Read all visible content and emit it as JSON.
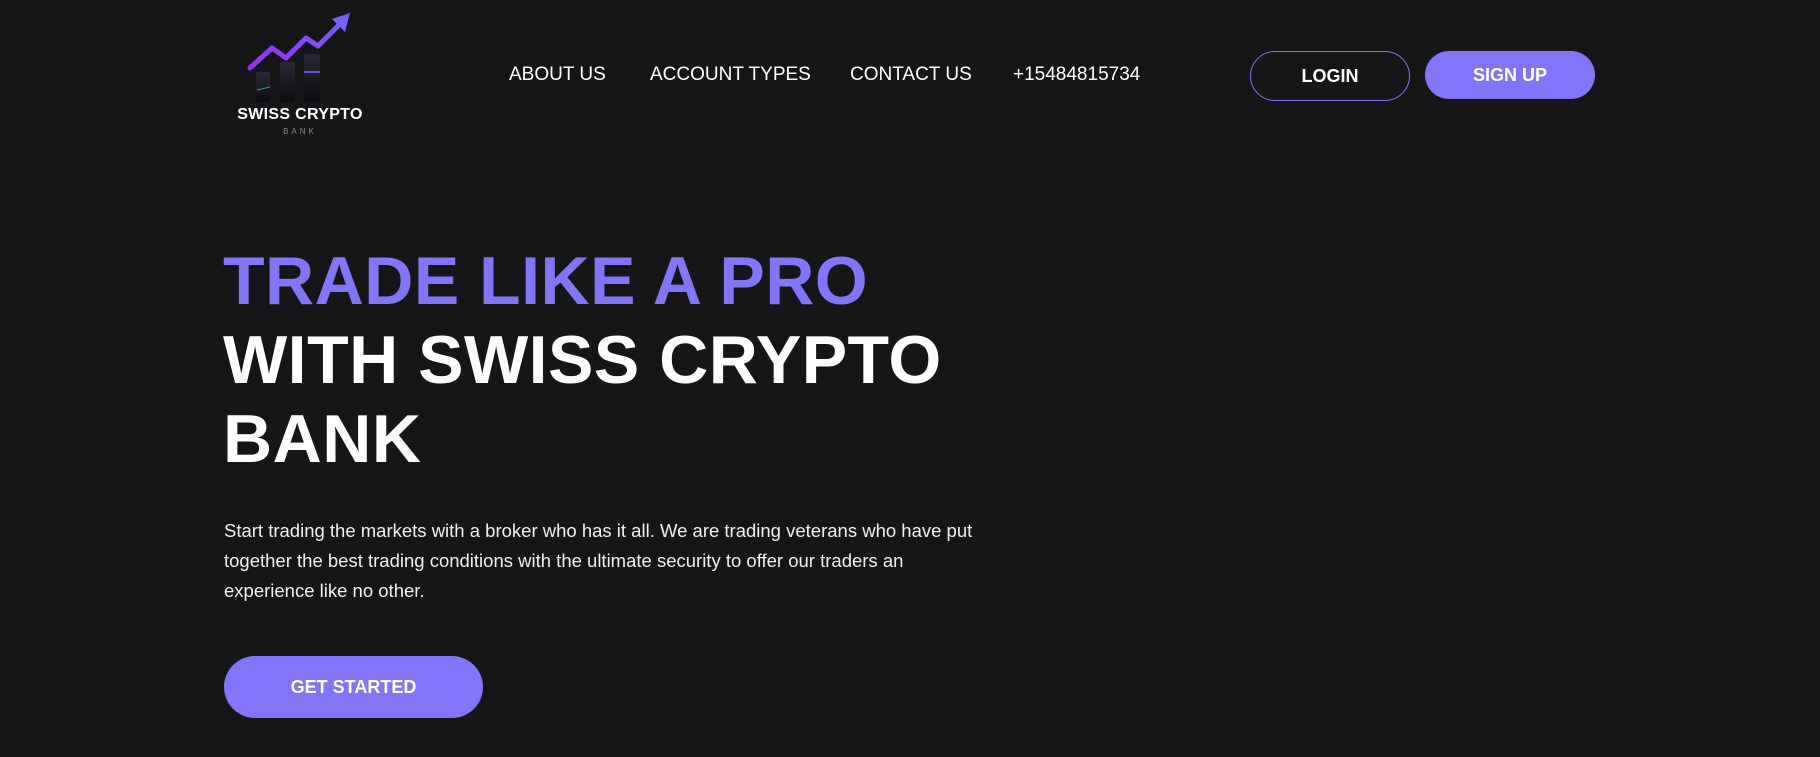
{
  "brand": {
    "name": "SWISS CRYPTO",
    "subname": "BANK",
    "accent_color": "#8275f7",
    "background_color": "#161618"
  },
  "nav": {
    "items": [
      {
        "label": "ABOUT US"
      },
      {
        "label": "ACCOUNT TYPES"
      },
      {
        "label": "CONTACT US"
      },
      {
        "label": "+15484815734"
      }
    ]
  },
  "auth": {
    "login_label": "LOGIN",
    "signup_label": "SIGN UP"
  },
  "hero": {
    "title_accent": "TRADE LIKE A PRO",
    "title_line_2": "WITH SWISS CRYPTO",
    "title_line_3": "BANK",
    "description": "Start trading the markets with a broker who has it all. We are trading veterans who have put together the best trading conditions with the ultimate security to offer our traders an experience like no other.",
    "cta_label": "GET STARTED"
  }
}
